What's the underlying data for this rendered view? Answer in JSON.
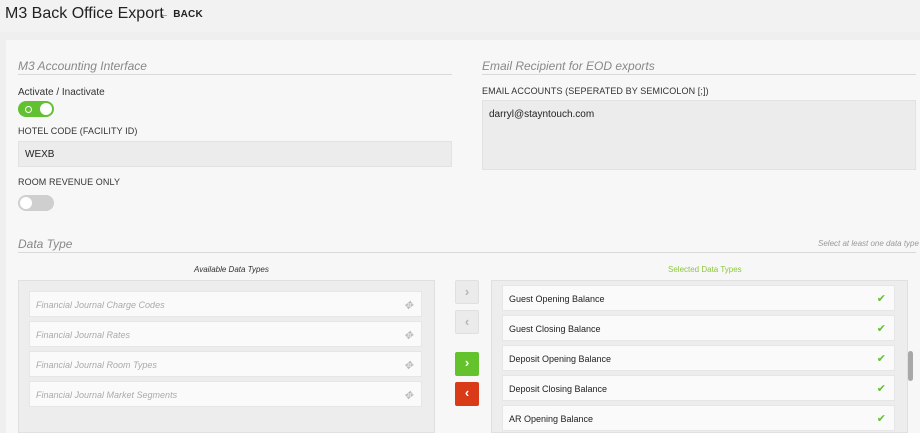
{
  "header": {
    "title": "M3 Back Office Export",
    "back_label": "BACK"
  },
  "accounting": {
    "section_title": "M3 Accounting Interface",
    "activate_label": "Activate / Inactivate",
    "activate_on": true,
    "hotel_code_label": "HOTEL CODE (FACILITY ID)",
    "hotel_code_value": "WEXB",
    "room_revenue_label": "ROOM REVENUE ONLY",
    "room_revenue_on": false
  },
  "email": {
    "section_title": "Email Recipient for EOD exports",
    "accounts_label": "EMAIL ACCOUNTS (SEPERATED BY SEMICOLON [;])",
    "accounts_value": "darryl@stayntouch.com"
  },
  "data_type": {
    "section_title": "Data Type",
    "hint": "Select at least one data type",
    "available_title": "Available Data Types",
    "selected_title": "Selected Data Types",
    "available": [
      "Financial Journal Charge Codes",
      "Financial Journal Rates",
      "Financial Journal Room Types",
      "Financial Journal Market Segments"
    ],
    "selected": [
      "Guest Opening Balance",
      "Guest Closing Balance",
      "Deposit Opening Balance",
      "Deposit Closing Balance",
      "AR Opening Balance"
    ],
    "buttons": {
      "add_all": "›",
      "remove_all": "‹",
      "add": "›",
      "remove": "‹"
    }
  },
  "colors": {
    "accent_green": "#62c132",
    "danger_red": "#d93a18"
  },
  "icons": {
    "back": "arrow-left-icon",
    "drag": "move-icon",
    "check": "check-icon"
  }
}
